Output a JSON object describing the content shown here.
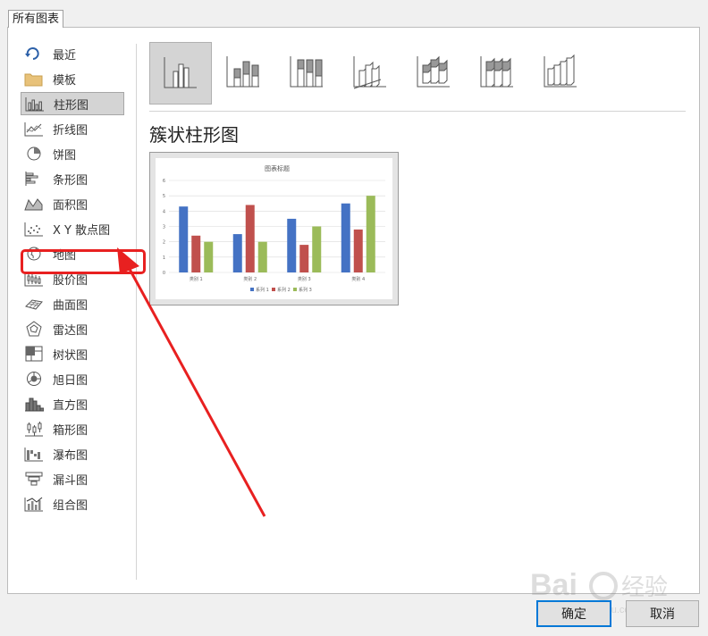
{
  "tab_label": "所有图表",
  "sidebar": {
    "items": [
      {
        "label": "最近",
        "icon": "recent-icon"
      },
      {
        "label": "模板",
        "icon": "folder-icon"
      },
      {
        "label": "柱形图",
        "icon": "column-chart-icon",
        "selected": true
      },
      {
        "label": "折线图",
        "icon": "line-chart-icon"
      },
      {
        "label": "饼图",
        "icon": "pie-chart-icon"
      },
      {
        "label": "条形图",
        "icon": "bar-chart-icon"
      },
      {
        "label": "面积图",
        "icon": "area-chart-icon"
      },
      {
        "label": "X Y 散点图",
        "icon": "scatter-chart-icon",
        "highlighted": true
      },
      {
        "label": "地图",
        "icon": "map-chart-icon"
      },
      {
        "label": "股价图",
        "icon": "stock-chart-icon"
      },
      {
        "label": "曲面图",
        "icon": "surface-chart-icon"
      },
      {
        "label": "雷达图",
        "icon": "radar-chart-icon"
      },
      {
        "label": "树状图",
        "icon": "treemap-chart-icon"
      },
      {
        "label": "旭日图",
        "icon": "sunburst-chart-icon"
      },
      {
        "label": "直方图",
        "icon": "histogram-chart-icon"
      },
      {
        "label": "箱形图",
        "icon": "box-whisker-chart-icon"
      },
      {
        "label": "瀑布图",
        "icon": "waterfall-chart-icon"
      },
      {
        "label": "漏斗图",
        "icon": "funnel-chart-icon"
      },
      {
        "label": "组合图",
        "icon": "combo-chart-icon"
      }
    ]
  },
  "subtypes": [
    {
      "icon": "clustered-column-icon",
      "selected": true
    },
    {
      "icon": "stacked-column-icon"
    },
    {
      "icon": "100-stacked-column-icon"
    },
    {
      "icon": "3d-clustered-column-icon"
    },
    {
      "icon": "3d-stacked-column-icon"
    },
    {
      "icon": "3d-100-stacked-column-icon"
    },
    {
      "icon": "3d-column-icon"
    }
  ],
  "subtype_title": "簇状柱形图",
  "buttons": {
    "ok": "确定",
    "cancel": "取消"
  },
  "annotation_color": "#e82020",
  "chart_data": {
    "type": "bar",
    "title": "图表标题",
    "categories": [
      "类别 1",
      "类别 2",
      "类别 3",
      "类别 4"
    ],
    "series": [
      {
        "name": "系列 1",
        "values": [
          4.3,
          2.5,
          3.5,
          4.5
        ],
        "color": "#4472c4"
      },
      {
        "name": "系列 2",
        "values": [
          2.4,
          4.4,
          1.8,
          2.8
        ],
        "color": "#c0504d"
      },
      {
        "name": "系列 3",
        "values": [
          2,
          2,
          3,
          5
        ],
        "color": "#9bbb59"
      }
    ],
    "ylim": [
      0,
      6
    ],
    "yticks": [
      "0",
      "1",
      "2",
      "3",
      "4",
      "5",
      "6"
    ],
    "grid": true,
    "legend": "bottom"
  }
}
